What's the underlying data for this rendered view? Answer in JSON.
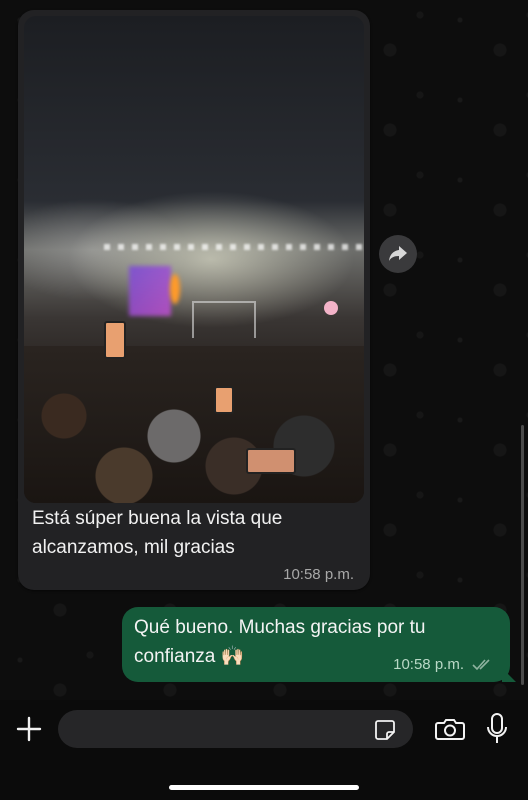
{
  "messages": [
    {
      "direction": "incoming",
      "has_media": true,
      "text": "Está súper buena la vista que alcanzamos, mil gracias",
      "time": "10:58 p.m."
    },
    {
      "direction": "outgoing",
      "text": "Qué bueno. Muchas gracias por tu confianza 🙌🏻",
      "time": "10:58 p.m.",
      "status": "read"
    }
  ],
  "composer": {
    "placeholder": "",
    "value": ""
  },
  "icons": {
    "forward": "forward-icon",
    "plus": "plus-icon",
    "sticker": "sticker-icon",
    "camera": "camera-icon",
    "mic": "microphone-icon",
    "read_receipt": "double-check-icon"
  },
  "colors": {
    "incoming_bubble": "#222224",
    "outgoing_bubble": "#155a3a",
    "read_receipt": "#8fb3a0"
  }
}
